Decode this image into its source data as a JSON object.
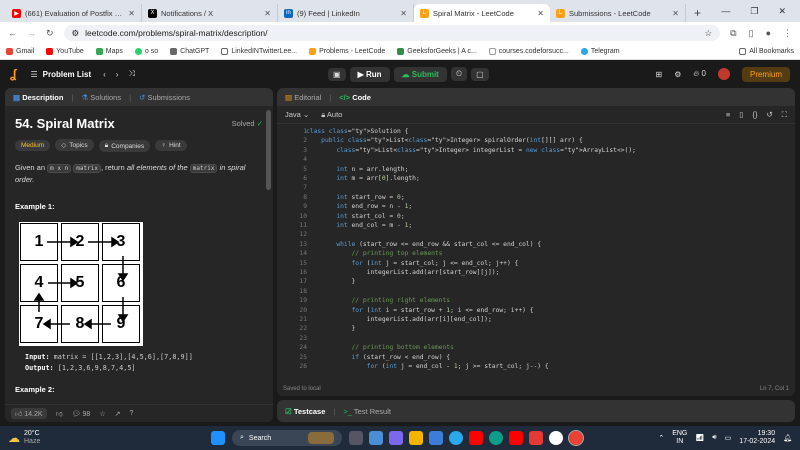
{
  "browser": {
    "tabs": [
      {
        "title": "(661) Evaluation of Postfix Expr",
        "color": "#ff0000",
        "glyph": "▶"
      },
      {
        "title": "Notifications / X",
        "color": "#000000",
        "glyph": "X"
      },
      {
        "title": "(9) Feed | LinkedIn",
        "color": "#0a66c2",
        "glyph": "in"
      },
      {
        "title": "Spiral Matrix - LeetCode",
        "color": "#ffa116",
        "glyph": "L"
      },
      {
        "title": "Submissions - LeetCode",
        "color": "#ffa116",
        "glyph": "L"
      }
    ],
    "url": "leetcode.com/problems/spiral-matrix/description/",
    "bookmarks": [
      "Gmail",
      "YouTube",
      "Maps",
      "o so",
      "ChatGPT",
      "LinkedINTwitterLee...",
      "Problems - LeetCode",
      "GeeksforGeeks | A c...",
      "courses.codeforsucc...",
      "Telegram"
    ],
    "all_bookmarks": "All Bookmarks"
  },
  "lcnav": {
    "problem_list": "Problem List",
    "run": "Run",
    "submit": "Submit",
    "fire_count": "0",
    "premium": "Premium"
  },
  "left": {
    "tabs": [
      "Description",
      "Solutions",
      "Submissions"
    ],
    "title": "54. Spiral Matrix",
    "solved": "Solved",
    "tags": [
      "Medium",
      "Topics",
      "Companies",
      "Hint"
    ],
    "desc_prefix": "Given an",
    "desc_code1": "m x n",
    "desc_code2": "matrix",
    "desc_mid": ", return",
    "desc_em": "all elements of the",
    "desc_code3": "matrix",
    "desc_end": "in spiral order.",
    "example1": "Example 1:",
    "grid": [
      "1",
      "2",
      "3",
      "4",
      "5",
      "6",
      "7",
      "8",
      "9"
    ],
    "input_label": "Input:",
    "input_val": "matrix = [[1,2,3],[4,5,6],[7,8,9]]",
    "output_label": "Output:",
    "output_val": "[1,2,3,6,9,8,7,4,5]",
    "example2": "Example 2:",
    "likes": "14.2K",
    "comments": "98"
  },
  "editor": {
    "tabs": [
      "Editorial",
      "Code"
    ],
    "language": "Java",
    "auto": "Auto",
    "saved": "Saved to local",
    "position": "Ln 7, Col 1",
    "lines": [
      "class Solution {",
      "    public List<Integer> spiralOrder(int[][] arr) {",
      "        List<Integer> integerList = new ArrayList<>();",
      "",
      "        int n = arr.length;",
      "        int m = arr[0].length;",
      "",
      "        int start_row = 0;",
      "        int end_row = n - 1;",
      "        int start_col = 0;",
      "        int end_col = m - 1;",
      "",
      "        while (start_row <= end_row && start_col <= end_col) {",
      "            // printing top elements",
      "            for (int j = start_col; j <= end_col; j++) {",
      "                integerList.add(arr[start_row][j]);",
      "            }",
      "",
      "            // printing right elements",
      "            for (int i = start_row + 1; i <= end_row; i++) {",
      "                integerList.add(arr[i][end_col]);",
      "            }",
      "",
      "            // printing bottom elements",
      "            if (start_row < end_row) {",
      "                for (int j = end_col - 1; j >= start_col; j--) {"
    ]
  },
  "bottom": {
    "testcase": "Testcase",
    "test_result": "Test Result"
  },
  "taskbar": {
    "weather_temp": "20°C",
    "weather_desc": "Haze",
    "search": "Search",
    "lang": "ENG",
    "region": "IN",
    "time": "19:30",
    "date": "17-02-2024"
  }
}
